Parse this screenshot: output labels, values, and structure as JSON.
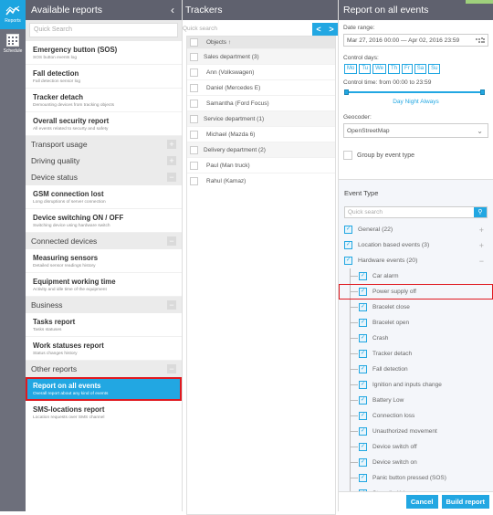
{
  "rail": {
    "items": [
      {
        "label": "Reports",
        "icon": "chart-line-icon",
        "active": true
      },
      {
        "label": "Schedule",
        "icon": "calendar-grid-icon",
        "active": false
      }
    ]
  },
  "reports_panel": {
    "title": "Available reports",
    "collapse_icon": "chevron-left-icon",
    "search_placeholder": "Quick Search",
    "security_items": [
      {
        "title": "Emergency button (SOS)",
        "subtitle": "SOS button events log"
      },
      {
        "title": "Fall detection",
        "subtitle": "Fall detection sensor log"
      },
      {
        "title": "Tracker detach",
        "subtitle": "Demounting devices from tracking objects"
      },
      {
        "title": "Overall security report",
        "subtitle": "All events related to securty and safety"
      }
    ],
    "categories": {
      "transport_usage": {
        "label": "Transport usage",
        "state": "+"
      },
      "driving_quality": {
        "label": "Driving quality",
        "state": "+"
      },
      "device_status": {
        "label": "Device status",
        "state": "−"
      },
      "connected_devices": {
        "label": "Connected devices",
        "state": "−"
      },
      "business": {
        "label": "Business",
        "state": "−"
      },
      "other_reports": {
        "label": "Other reports",
        "state": "−"
      }
    },
    "device_status_items": [
      {
        "title": "GSM connection lost",
        "subtitle": "Long disruptions of server connection"
      },
      {
        "title": "Device switching ON / OFF",
        "subtitle": "Switching device using hardware switch"
      }
    ],
    "connected_devices_items": [
      {
        "title": "Measuring sensors",
        "subtitle": "Detailed sensor readings history"
      },
      {
        "title": "Equipment working time",
        "subtitle": "Activity and idle time of the equipment"
      }
    ],
    "business_items": [
      {
        "title": "Tasks report",
        "subtitle": "Tasks statuses"
      },
      {
        "title": "Work statuses report",
        "subtitle": "Status changes history"
      }
    ],
    "other_items": [
      {
        "title": "Report on all events",
        "subtitle": "Overall report about any kind of events",
        "active": true
      },
      {
        "title": "SMS-locations report",
        "subtitle": "Location requests over SMS channel"
      }
    ]
  },
  "trackers_panel": {
    "title": "Trackers",
    "search_placeholder": "Quick search",
    "nav_prev": "<",
    "nav_next": ">",
    "header": "Objects ↑",
    "groups": [
      {
        "name": "Sales department (3)",
        "items": [
          "Ann (Volkswagen)",
          "Daniel (Mercedes E)",
          "Samantha (Ford Focus)"
        ]
      },
      {
        "name": "Service department (1)",
        "items": [
          "Michael (Mazda 6)"
        ]
      },
      {
        "name": "Delivery department (2)",
        "items": [
          "Paul (Man truck)",
          "Rahul (Kamaz)"
        ]
      }
    ]
  },
  "report_panel": {
    "title": "Report on all events",
    "date_range_label": "Date range:",
    "date_range_value": "Mar 27, 2016 00:00 — Apr 02, 2016 23:59",
    "calendar_icon": "calendar-icon",
    "control_days_label": "Control days:",
    "days": [
      "Mo",
      "Tu",
      "We",
      "Th",
      "Fr",
      "Sa",
      "Su"
    ],
    "control_time_label": "Control time: from 00:00 to 23:59",
    "time_range": {
      "from": "00:00",
      "to": "23:59"
    },
    "presets": [
      "Day",
      "Night",
      "Always"
    ],
    "geocoder_label": "Geocoder:",
    "geocoder_value": "OpenStreetMap",
    "group_by_label": "Group by event type",
    "event_type_title": "Event Type",
    "event_search_placeholder": "Quick search",
    "top_groups": [
      {
        "label": "General (22)",
        "state": "+"
      },
      {
        "label": "Location based events (3)",
        "state": "+"
      },
      {
        "label": "Hardware events (20)",
        "state": "−"
      }
    ],
    "hardware_events": [
      "Car alarm",
      "Power supply off",
      "Bracelet close",
      "Bracelet open",
      "Crash",
      "Tracker detach",
      "Fall detection",
      "Ignition and inputs change",
      "Battery Low",
      "Connection loss",
      "Unauthorized movement",
      "Device switch off",
      "Device switch on",
      "Panic button pressed (SOS)",
      "Strap (bolt) is cut"
    ],
    "cancel_label": "Cancel",
    "build_label": "Build report"
  }
}
